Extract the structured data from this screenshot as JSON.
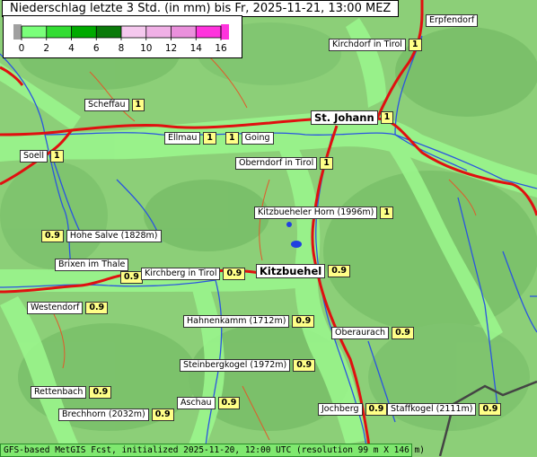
{
  "title": "Niederschlag letzte 3 Std. (in mm) bis Fr, 2025-11-21, 13:00 MEZ",
  "legend": {
    "ticks": [
      "0",
      "2",
      "4",
      "6",
      "8",
      "10",
      "12",
      "14",
      "16"
    ],
    "colors": [
      "#a0a0a0",
      "#7aff7a",
      "#33dd33",
      "#00aa00",
      "#0a7a0a",
      "#f5c8ee",
      "#f0b0e6",
      "#ea90dc",
      "#ff33dd"
    ]
  },
  "places": [
    {
      "name": "Erpfendorf",
      "value": ""
    },
    {
      "name": "Kirchdorf in Tirol",
      "value": "1"
    },
    {
      "name": "Scheffau",
      "value": "1"
    },
    {
      "name": "St. Johann",
      "value": "1"
    },
    {
      "name": "Ellmau",
      "value": "1"
    },
    {
      "name": "Going",
      "value": "1"
    },
    {
      "name": "Soell",
      "value": "1"
    },
    {
      "name": "Oberndorf in Tirol",
      "value": "1"
    },
    {
      "name": "Kitzbueheler Horn (1996m)",
      "value": "1"
    },
    {
      "name": "Hohe Salve (1828m)",
      "value": "0.9"
    },
    {
      "name": "Brixen im Thale",
      "value": "0.9"
    },
    {
      "name": "Kirchberg in Tirol",
      "value": "0.9"
    },
    {
      "name": "Kitzbuehel",
      "value": "0.9"
    },
    {
      "name": "Westendorf",
      "value": "0.9"
    },
    {
      "name": "Hahnenkamm (1712m)",
      "value": "0.9"
    },
    {
      "name": "Oberaurach",
      "value": "0.9"
    },
    {
      "name": "Steinbergkogel (1972m)",
      "value": "0.9"
    },
    {
      "name": "Rettenbach",
      "value": "0.9"
    },
    {
      "name": "Aschau",
      "value": "0.9"
    },
    {
      "name": "Brechhorn (2032m)",
      "value": "0.9"
    },
    {
      "name": "Jochberg",
      "value": "0.9"
    },
    {
      "name": "Staffkogel (2111m)",
      "value": "0.9"
    }
  ],
  "footer": "GFS-based MetGIS Fcst, initialized 2025-11-20, 12:00 UTC  (resolution 99 m X 146 m)"
}
